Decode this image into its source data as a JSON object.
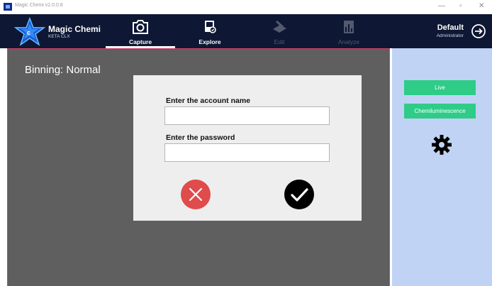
{
  "window": {
    "title": "Magic Chemi v2.0.0.8",
    "minimize": "—",
    "maximize": "▫",
    "close": "✕"
  },
  "brand": {
    "name": "Magic Chemi",
    "model": "KETA CLX"
  },
  "nav": [
    {
      "label": "Capture",
      "icon": "camera-icon",
      "active": true,
      "enabled": true
    },
    {
      "label": "Explore",
      "icon": "image-search-icon",
      "active": false,
      "enabled": true
    },
    {
      "label": "Edit",
      "icon": "pen-icon",
      "active": false,
      "enabled": false
    },
    {
      "label": "Analyze",
      "icon": "chart-icon",
      "active": false,
      "enabled": false
    }
  ],
  "user": {
    "name": "Default",
    "role": "Administrator",
    "logout_icon": "logout-icon"
  },
  "main": {
    "binning": "Binning: Normal"
  },
  "right_panel": {
    "live_label": "Live",
    "mode_label": "Chemiluminescence",
    "settings_icon": "gear-icon"
  },
  "dialog": {
    "account_label": "Enter the account name",
    "account_value": "",
    "password_label": "Enter the password",
    "password_value": "",
    "cancel_icon": "cancel-icon",
    "confirm_icon": "check-icon"
  },
  "colors": {
    "header": "#0e1733",
    "main_bg": "#5f5f5f",
    "panel_bg": "#c0d3f4",
    "accent_green": "#2ecc87",
    "cancel_red": "#e04b4b",
    "border_pink": "#d1406a"
  }
}
